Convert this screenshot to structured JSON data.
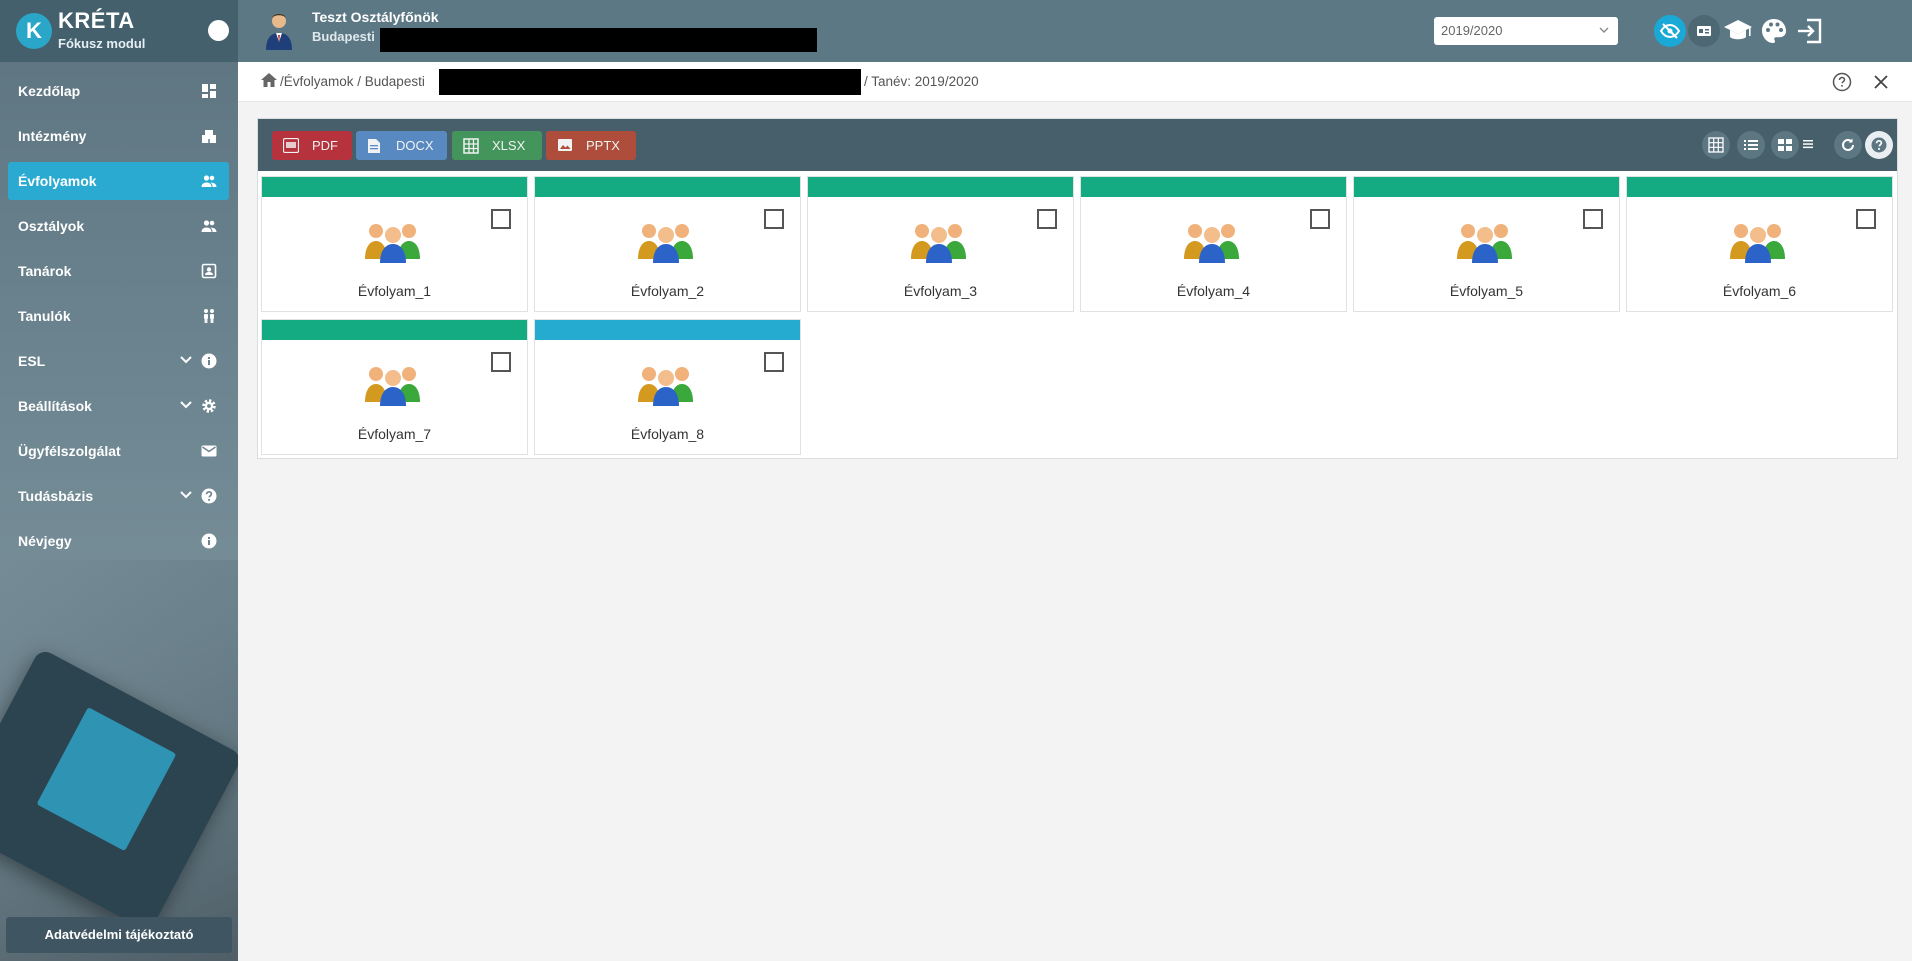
{
  "app": {
    "title": "KRÉTA",
    "subtitle": "Fókusz modul"
  },
  "user": {
    "name": "Teszt Osztályfőnök",
    "school": "Budapesti"
  },
  "header": {
    "year_selected": "2019/2020"
  },
  "sidebar": {
    "items": [
      {
        "label": "Kezdőlap",
        "icon": "dashboard-icon"
      },
      {
        "label": "Intézmény",
        "icon": "building-icon"
      },
      {
        "label": "Évfolyamok",
        "icon": "people-icon",
        "active": true
      },
      {
        "label": "Osztályok",
        "icon": "people-icon"
      },
      {
        "label": "Tanárok",
        "icon": "contact-card-icon"
      },
      {
        "label": "Tanulók",
        "icon": "students-icon"
      },
      {
        "label": "ESL",
        "icon": "info-icon",
        "expandable": true
      },
      {
        "label": "Beállítások",
        "icon": "gear-icon",
        "expandable": true
      },
      {
        "label": "Ügyfélszolgálat",
        "icon": "mail-icon"
      },
      {
        "label": "Tudásbázis",
        "icon": "question-icon",
        "expandable": true
      },
      {
        "label": "Névjegy",
        "icon": "info-icon"
      }
    ],
    "privacy_button": "Adatvédelmi tájékoztató"
  },
  "breadcrumb": {
    "part1": "/Évfolyamok / Budapesti",
    "part2": "/ Tanév: 2019/2020"
  },
  "toolbar": {
    "pdf": "PDF",
    "docx": "DOCX",
    "xlsx": "XLSX",
    "pptx": "PPTX"
  },
  "tiles": [
    {
      "name": "Évfolyam_1",
      "color": "#14ab83"
    },
    {
      "name": "Évfolyam_2",
      "color": "#14ab83"
    },
    {
      "name": "Évfolyam_3",
      "color": "#14ab83"
    },
    {
      "name": "Évfolyam_4",
      "color": "#14ab83"
    },
    {
      "name": "Évfolyam_5",
      "color": "#14ab83"
    },
    {
      "name": "Évfolyam_6",
      "color": "#14ab83"
    },
    {
      "name": "Évfolyam_7",
      "color": "#14ab83"
    },
    {
      "name": "Évfolyam_8",
      "color": "#26abd0"
    }
  ]
}
